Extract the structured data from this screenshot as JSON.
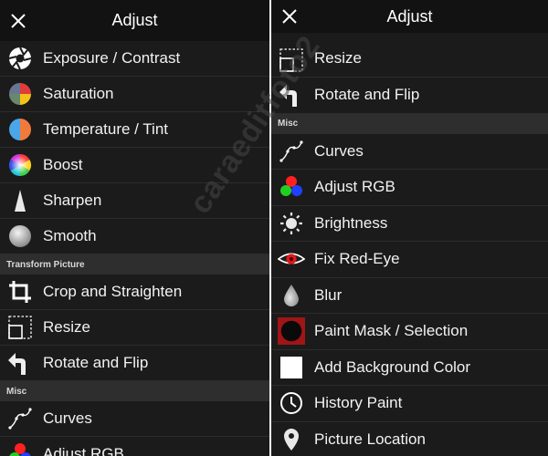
{
  "left": {
    "title": "Adjust",
    "items_a": [
      {
        "label": "Exposure / Contrast",
        "icon": "aperture-icon"
      },
      {
        "label": "Saturation",
        "icon": "saturation-icon"
      },
      {
        "label": "Temperature / Tint",
        "icon": "temperature-icon"
      },
      {
        "label": "Boost",
        "icon": "boost-icon"
      },
      {
        "label": "Sharpen",
        "icon": "sharpen-icon"
      },
      {
        "label": "Smooth",
        "icon": "smooth-icon"
      }
    ],
    "section_transform": "Transform Picture",
    "items_b": [
      {
        "label": "Crop and Straighten",
        "icon": "crop-icon"
      },
      {
        "label": "Resize",
        "icon": "resize-icon"
      },
      {
        "label": "Rotate and Flip",
        "icon": "rotate-icon"
      }
    ],
    "section_misc": "Misc",
    "items_c": [
      {
        "label": "Curves",
        "icon": "curves-icon"
      },
      {
        "label": "Adjust RGB",
        "icon": "rgb-icon"
      }
    ]
  },
  "right": {
    "title": "Adjust",
    "items_a": [
      {
        "label": "Resize",
        "icon": "resize-icon"
      },
      {
        "label": "Rotate and Flip",
        "icon": "rotate-icon"
      }
    ],
    "section_misc": "Misc",
    "items_b": [
      {
        "label": "Curves",
        "icon": "curves-icon"
      },
      {
        "label": "Adjust RGB",
        "icon": "rgb-icon"
      },
      {
        "label": "Brightness",
        "icon": "brightness-icon"
      },
      {
        "label": "Fix Red-Eye",
        "icon": "red-eye-icon"
      },
      {
        "label": "Blur",
        "icon": "blur-icon"
      },
      {
        "label": "Paint Mask / Selection",
        "icon": "paint-mask-icon"
      },
      {
        "label": "Add Background Color",
        "icon": "background-color-icon"
      },
      {
        "label": "History Paint",
        "icon": "history-icon"
      },
      {
        "label": "Picture Location",
        "icon": "location-pin-icon"
      }
    ]
  },
  "watermark": "caraeditfoto2"
}
